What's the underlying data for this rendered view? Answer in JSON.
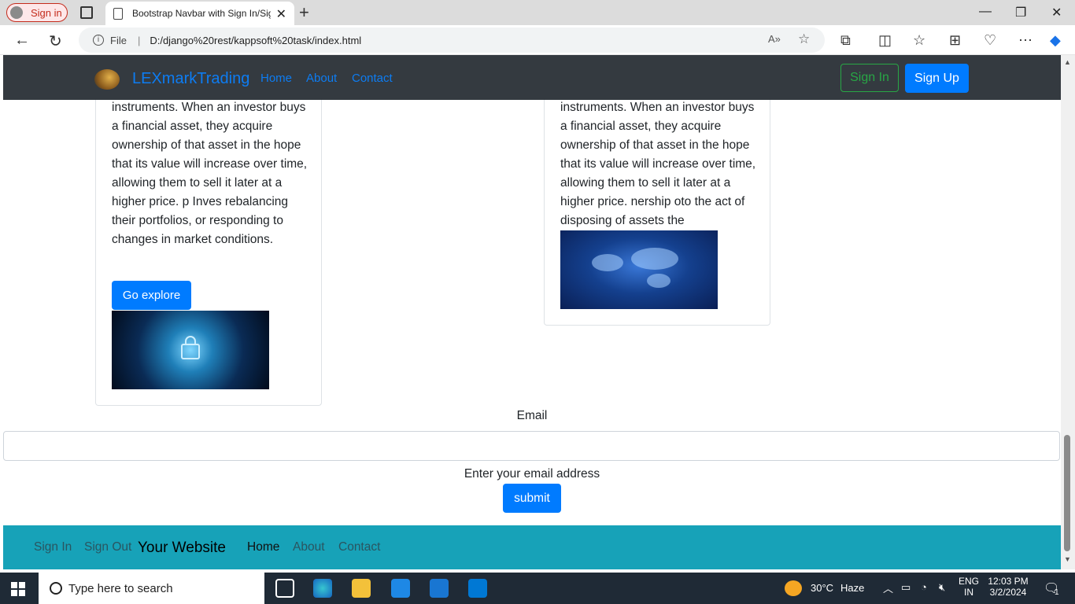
{
  "browser": {
    "profile_label": "Sign in",
    "tab_title": "Bootstrap Navbar with Sign In/Sign Up",
    "url_prefix": "File",
    "url": "D:/django%20rest/kappsoft%20task/index.html"
  },
  "navbar": {
    "brand": "LEXmarkTrading",
    "links": [
      "Home",
      "About",
      "Contact"
    ],
    "signin": "Sign In",
    "signup": "Sign Up"
  },
  "cards": {
    "left_text": "instruments. When an investor buys a financial asset, they acquire ownership of that asset in the hope that its value will increase over time, allowing them to sell it later at a higher price. p Inves rebalancing their portfolios, or responding to changes in market conditions.",
    "left_button": "Go explore",
    "right_text": "instruments. When an investor buys a financial asset, they acquire ownership of that asset in the hope that its value will increase over time, allowing them to sell it later at a higher price. nership oto the act of disposing of assets the"
  },
  "form": {
    "email_label": "Email",
    "email_value": "",
    "help_text": "Enter your email address",
    "submit": "submit"
  },
  "footer": {
    "signin": "Sign In",
    "signout": "Sign Out",
    "brand": "Your Website",
    "links": [
      "Home",
      "About",
      "Contact"
    ]
  },
  "taskbar": {
    "search_placeholder": "Type here to search",
    "weather_temp": "30°C",
    "weather_desc": "Haze",
    "lang_1": "ENG",
    "lang_2": "IN",
    "time": "12:03 PM",
    "date": "3/2/2024",
    "notification_count": "1"
  },
  "colors": {
    "navbar_bg": "#343a40",
    "primary": "#007bff",
    "success": "#28a745",
    "footer_bg": "#17a2b8"
  }
}
